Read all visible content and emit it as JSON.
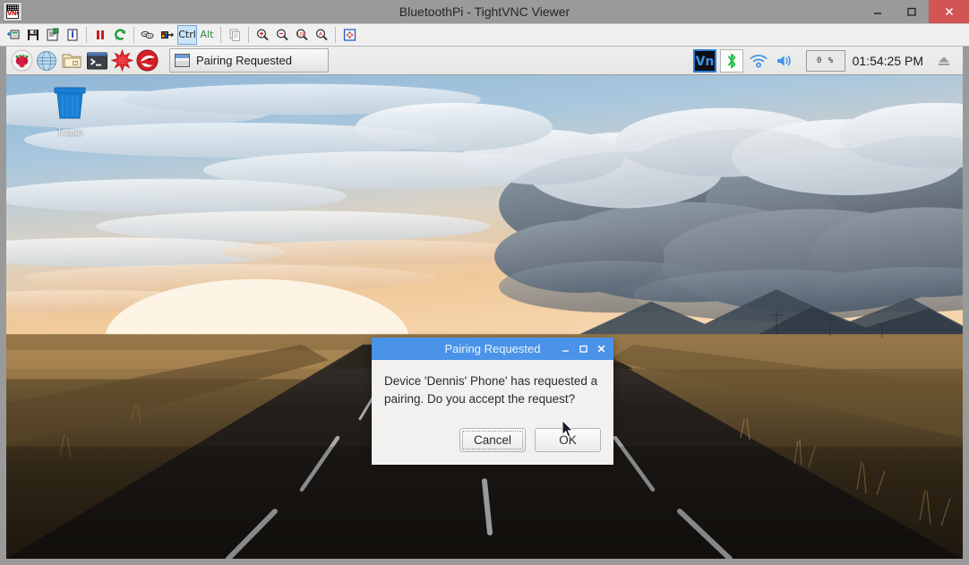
{
  "window": {
    "title": "BluetoothPi - TightVNC Viewer",
    "app_icon": "vnc-icon",
    "controls": {
      "minimize": "minimize",
      "maximize": "maximize",
      "close": "close"
    }
  },
  "toolbar": {
    "buttons": [
      {
        "name": "new-connection-icon",
        "tip": "New connection"
      },
      {
        "name": "save-session-icon",
        "tip": "Save session"
      },
      {
        "name": "connection-options-icon",
        "tip": "Connection options"
      },
      {
        "name": "connection-info-icon",
        "tip": "Connection info"
      },
      {
        "name": "pause-icon",
        "tip": "Pause updates"
      },
      {
        "name": "refresh-icon",
        "tip": "Request screen refresh"
      },
      {
        "name": "send-ctrl-alt-del-icon",
        "tip": "Send Ctrl-Alt-Del"
      },
      {
        "name": "send-key-icon",
        "tip": "Send key"
      },
      {
        "name": "ctrl-key-toggle",
        "label": "Ctrl"
      },
      {
        "name": "alt-key-toggle",
        "label": "Alt"
      },
      {
        "name": "transfer-files-icon",
        "tip": "Transfer files"
      },
      {
        "name": "zoom-in-icon",
        "tip": "Zoom in"
      },
      {
        "name": "zoom-out-icon",
        "tip": "Zoom out"
      },
      {
        "name": "zoom-100-icon",
        "label": "100",
        "tip": "Zoom 100%"
      },
      {
        "name": "zoom-auto-icon",
        "label": "A",
        "tip": "Auto zoom"
      },
      {
        "name": "fullscreen-icon",
        "tip": "Full screen"
      }
    ]
  },
  "taskbar": {
    "launchers": [
      {
        "name": "raspberry-menu-icon",
        "label": "Menu"
      },
      {
        "name": "web-browser-icon",
        "label": "Web Browser"
      },
      {
        "name": "file-manager-icon",
        "label": "File Manager"
      },
      {
        "name": "terminal-icon",
        "label": "Terminal"
      },
      {
        "name": "mathematica-icon",
        "label": "Mathematica"
      },
      {
        "name": "wolfram-icon",
        "label": "Wolfram"
      }
    ],
    "task_button": {
      "label": "Pairing Requested",
      "icon": "window-icon"
    },
    "tray": [
      {
        "name": "vnc-server-tray-icon",
        "label": "VNC"
      },
      {
        "name": "bluetooth-tray-icon",
        "label": "Bluetooth"
      },
      {
        "name": "wifi-tray-icon",
        "label": "Wireless Network"
      },
      {
        "name": "volume-tray-icon",
        "label": "Volume"
      }
    ],
    "cpu_meter": "0 %",
    "clock": "01:54:25 PM",
    "eject_icon": "eject-icon"
  },
  "desktop": {
    "icons": [
      {
        "name": "trash-icon",
        "label": "Trash"
      }
    ]
  },
  "dialog": {
    "title": "Pairing Requested",
    "message": "Device 'Dennis' Phone' has requested a pairing. Do you accept the request?",
    "buttons": {
      "cancel": "Cancel",
      "ok": "OK"
    },
    "controls": {
      "minimize": "minimize",
      "maximize": "maximize",
      "close": "close"
    }
  },
  "colors": {
    "window_chrome": "#9a9a9a",
    "close_button": "#d35454",
    "dialog_titlebar": "#4a93e8",
    "taskbar": "#ececea",
    "ctrl_toggle_active": "#cce4f7",
    "bluetooth_green": "#22c24a",
    "trash_blue": "#1a7fd4"
  }
}
